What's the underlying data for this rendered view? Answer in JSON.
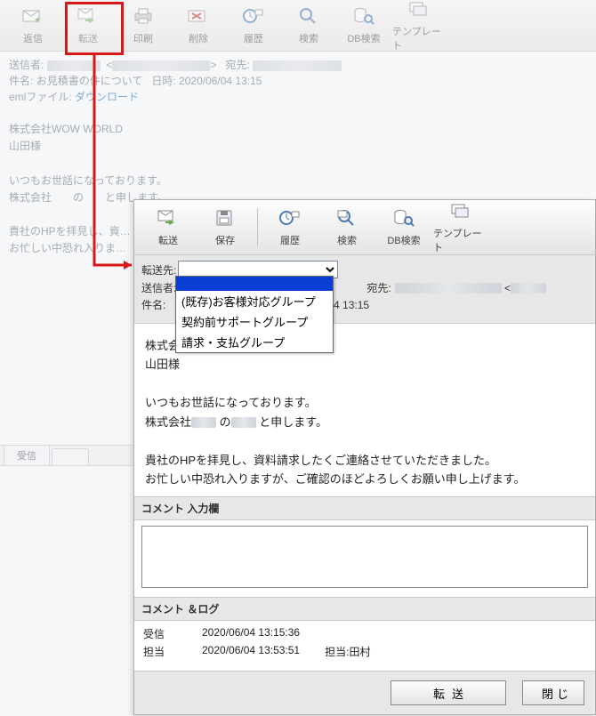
{
  "bg_toolbar": {
    "reply": "返信",
    "forward": "転送",
    "print": "印刷",
    "delete": "削除",
    "history": "履歴",
    "search": "検索",
    "db_search": "DB検索",
    "template": "テンプレート"
  },
  "bg_header": {
    "sender_label": "送信者:",
    "to_label": "宛先:",
    "subject_label": "件名:",
    "subject_value": "お見積書の件について",
    "date_label": "日時:",
    "date_value": "2020/06/04 13:15",
    "eml_label": "emlファイル:",
    "eml_link": "ダウンロード"
  },
  "bg_body": {
    "l1": "株式会社WOW WORLD",
    "l2": "山田様",
    "l3": "いつもお世話になっております。",
    "l4": "株式会社　　の　　と申します。",
    "l5": "貴社のHPを拝見し、資…",
    "l6": "お忙しい中恐れ入りま…"
  },
  "bg_tab_receive": "受信",
  "dlg_toolbar": {
    "forward": "転送",
    "save": "保存",
    "history": "履歴",
    "search": "検索",
    "db_search": "DB検索",
    "template": "テンプレート"
  },
  "fields": {
    "dest_label": "転送先:",
    "sender_label": "送信者:",
    "to_label": "宛先:",
    "subject_label": "件名:",
    "date_value": "/06/04 13:15"
  },
  "dropdown_options": [
    "",
    "(既存)お客様対応グループ",
    "契約前サポートグループ",
    "請求・支払グループ"
  ],
  "msg": {
    "l1": "株式会",
    "l2": "山田様",
    "l3": "いつもお世話になっております。",
    "l4a": "株式会社",
    "l4b": "の",
    "l4c": "と申します。",
    "l5": "貴社のHPを拝見し、資料請求したくご連絡させていただきました。",
    "l6": "お忙しい中恐れ入りますが、ご確認のほどよろしくお願い申し上げます。"
  },
  "comment_header": "コメント 入力欄",
  "log_header": "コメント ＆ログ",
  "log": {
    "recv_label": "受信",
    "recv_time": "2020/06/04 13:15:36",
    "assign_label": "担当",
    "assign_time": "2020/06/04 13:53:51",
    "assignee_label": "担当:",
    "assignee_name": "田村"
  },
  "buttons": {
    "forward": "転送",
    "close": "閉じ"
  }
}
